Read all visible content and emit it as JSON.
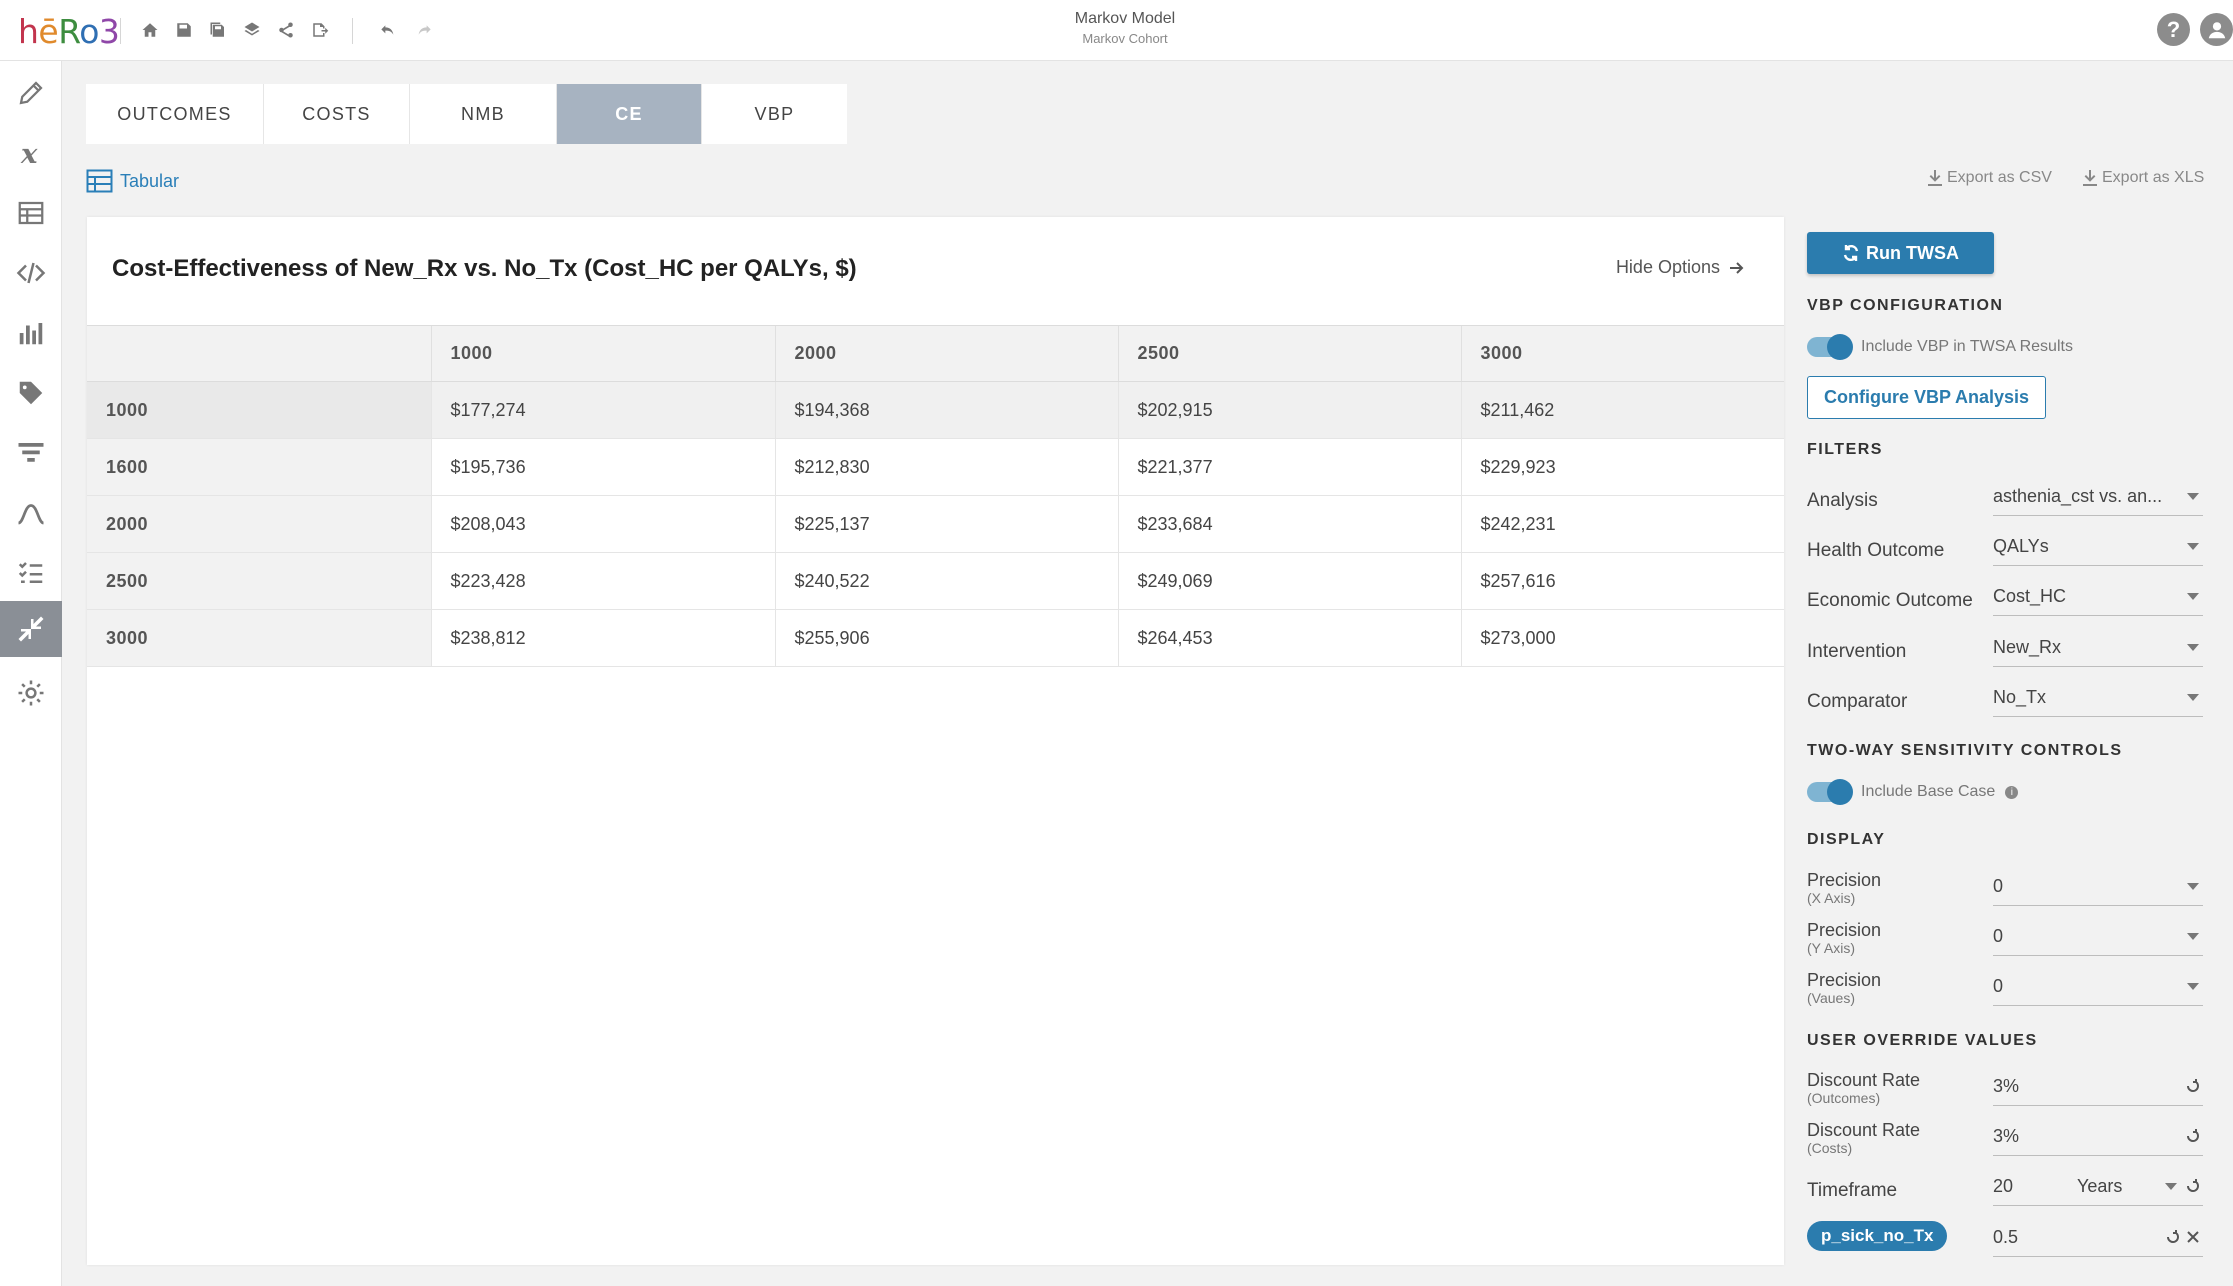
{
  "app": {
    "logo": [
      "h",
      "ē",
      "R",
      "o",
      "3"
    ],
    "model_title": "Markov Model",
    "model_subtitle": "Markov Cohort",
    "toolbar_icons": [
      "home-icon",
      "save-icon",
      "save-as-icon",
      "layers-icon",
      "share-icon",
      "export-icon"
    ],
    "help_label": "?"
  },
  "rail": [
    "pencil-icon",
    "variable-x-icon",
    "table-icon",
    "code-icon",
    "bar-chart-icon",
    "tag-icon",
    "filter-funnel-icon",
    "curve-icon",
    "checklist-icon",
    "compress-arrows-icon",
    "settings-gear-icon"
  ],
  "tabs": [
    {
      "label": "OUTCOMES",
      "active": false
    },
    {
      "label": "COSTS",
      "active": false
    },
    {
      "label": "NMB",
      "active": false
    },
    {
      "label": "CE",
      "active": true
    },
    {
      "label": "VBP",
      "active": false
    }
  ],
  "view": {
    "tabular_label": "Tabular",
    "export_csv": "Export as CSV",
    "export_xls": "Export as XLS"
  },
  "panel": {
    "title": "Cost-Effectiveness of New_Rx vs. No_Tx (Cost_HC per QALYs, $)",
    "hide_options": "Hide Options"
  },
  "table": {
    "columns": [
      "",
      "1000",
      "2000",
      "2500",
      "3000"
    ],
    "rows": [
      {
        "head": "1000",
        "values": [
          "$177,274",
          "$194,368",
          "$202,915",
          "$211,462"
        ]
      },
      {
        "head": "1600",
        "values": [
          "$195,736",
          "$212,830",
          "$221,377",
          "$229,923"
        ]
      },
      {
        "head": "2000",
        "values": [
          "$208,043",
          "$225,137",
          "$233,684",
          "$242,231"
        ]
      },
      {
        "head": "2500",
        "values": [
          "$223,428",
          "$240,522",
          "$249,069",
          "$257,616"
        ]
      },
      {
        "head": "3000",
        "values": [
          "$238,812",
          "$255,906",
          "$264,453",
          "$273,000"
        ]
      }
    ]
  },
  "options": {
    "run_label": "Run TWSA",
    "vbp_title": "VBP CONFIGURATION",
    "vbp_toggle_label": "Include VBP in TWSA Results",
    "configure_vbp": "Configure VBP Analysis",
    "filters_title": "FILTERS",
    "filters": [
      {
        "label": "Analysis",
        "value": "asthenia_cst vs. an..."
      },
      {
        "label": "Health Outcome",
        "value": "QALYs"
      },
      {
        "label": "Economic Outcome",
        "value": "Cost_HC"
      },
      {
        "label": "Intervention",
        "value": "New_Rx"
      },
      {
        "label": "Comparator",
        "value": "No_Tx"
      }
    ],
    "twsa_title": "TWO-WAY SENSITIVITY CONTROLS",
    "base_case_label": "Include Base Case",
    "display_title": "DISPLAY",
    "display": [
      {
        "label": "Precision",
        "sub": "(X Axis)",
        "value": "0"
      },
      {
        "label": "Precision",
        "sub": "(Y Axis)",
        "value": "0"
      },
      {
        "label": "Precision",
        "sub": "(Vaues)",
        "value": "0"
      }
    ],
    "override_title": "USER OVERRIDE VALUES",
    "overrides": [
      {
        "label": "Discount Rate",
        "sub": "(Outcomes)",
        "value": "3%"
      },
      {
        "label": "Discount Rate",
        "sub": "(Costs)",
        "value": "3%"
      }
    ],
    "timeframe": {
      "label": "Timeframe",
      "value": "20",
      "unit": "Years"
    },
    "param": {
      "name": "p_sick_no_Tx",
      "value": "0.5"
    }
  }
}
